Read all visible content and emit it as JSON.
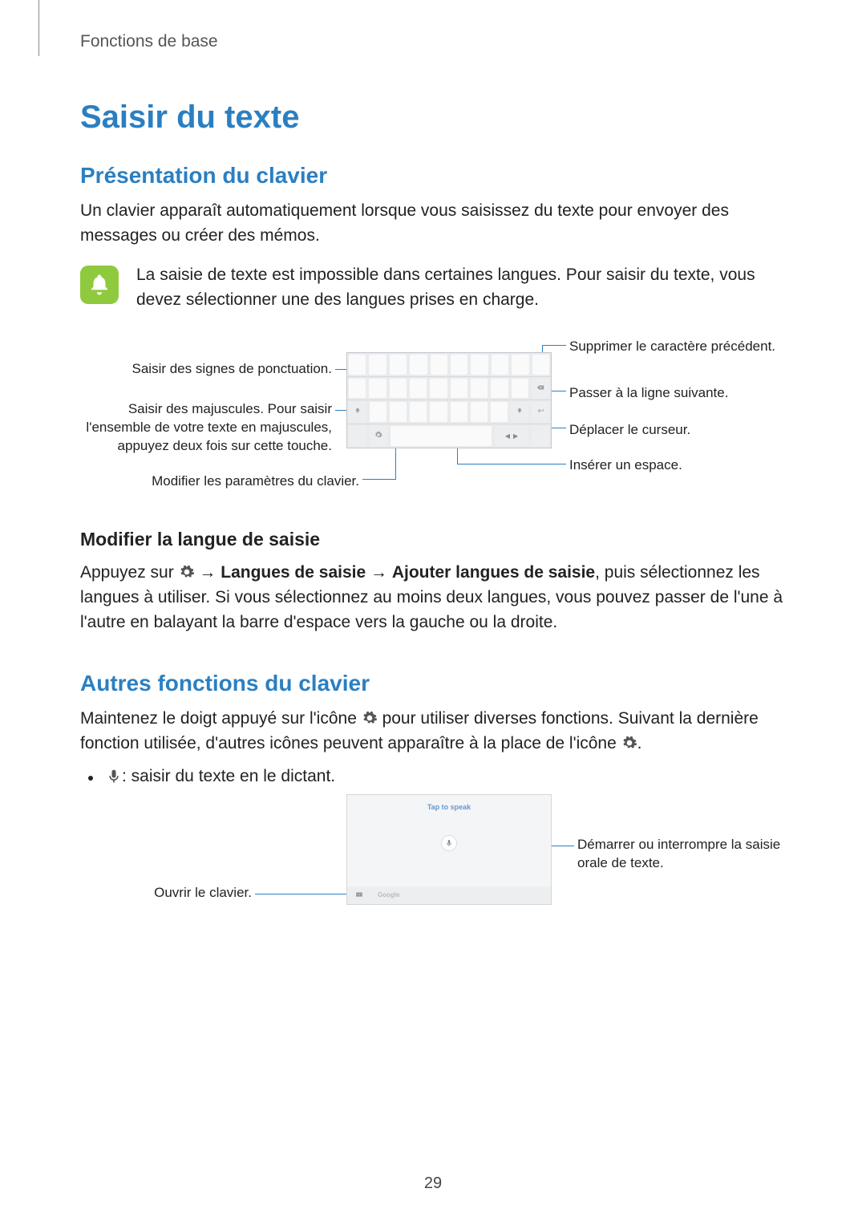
{
  "breadcrumb": "Fonctions de base",
  "h1": "Saisir du texte",
  "section1": {
    "title": "Présentation du clavier",
    "intro": "Un clavier apparaît automatiquement lorsque vous saisissez du texte pour envoyer des messages ou créer des mémos.",
    "note": "La saisie de texte est impossible dans certaines langues. Pour saisir du texte, vous devez sélectionner une des langues prises en charge."
  },
  "callouts_left": {
    "punct": "Saisir des signes de ponctuation.",
    "caps": "Saisir des majuscules. Pour saisir l'ensemble de votre texte en majuscules, appuyez deux fois sur cette touche.",
    "settings": "Modifier les paramètres du clavier."
  },
  "callouts_right": {
    "delete": "Supprimer le caractère précédent.",
    "newline": "Passer à la ligne suivante.",
    "cursor": "Déplacer le curseur.",
    "space": "Insérer un espace."
  },
  "section_lang": {
    "title": "Modifier la langue de saisie",
    "p_pre": "Appuyez sur ",
    "p_arrow1": " → ",
    "p_b1": "Langues de saisie",
    "p_arrow2": " → ",
    "p_b2": "Ajouter langues de saisie",
    "p_post": ", puis sélectionnez les langues à utiliser. Si vous sélectionnez au moins deux langues, vous pouvez passer de l'une à l'autre en balayant la barre d'espace vers la gauche ou la droite."
  },
  "section2": {
    "title": "Autres fonctions du clavier",
    "p_pre": "Maintenez le doigt appuyé sur l'icône ",
    "p_mid": " pour utiliser diverses fonctions. Suivant la dernière fonction utilisée, d'autres icônes peuvent apparaître à la place de l'icône ",
    "p_post": "."
  },
  "bullet_voice": " : saisir du texte en le dictant.",
  "voice_tap_label": "Tap to speak",
  "voice_foot_google": "Google",
  "callouts2": {
    "open_kbd": "Ouvrir le clavier.",
    "start_stop": "Démarrer ou interrompre la saisie orale de texte."
  },
  "page_number": "29"
}
